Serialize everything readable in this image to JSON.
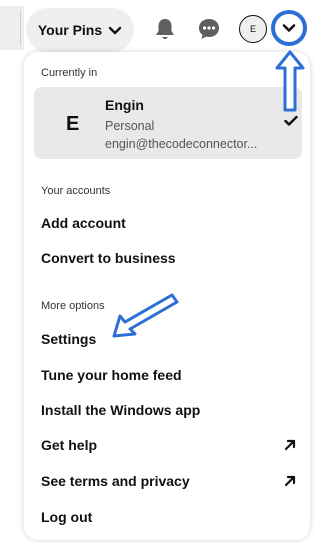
{
  "header": {
    "your_pins_label": "Your Pins",
    "avatar_initial": "E"
  },
  "current": {
    "section_label": "Currently in",
    "initial": "E",
    "name": "Engin",
    "type": "Personal",
    "email": "engin@thecodeconnector..."
  },
  "accounts": {
    "section_label": "Your accounts",
    "items": [
      "Add account",
      "Convert to business"
    ]
  },
  "more": {
    "section_label": "More options",
    "items": [
      "Settings",
      "Tune your home feed",
      "Install the Windows app",
      "Get help",
      "See terms and privacy",
      "Log out"
    ]
  },
  "icons": {
    "chevron": "chevron-down-icon",
    "bell": "bell-icon",
    "chat": "chat-bubble-icon",
    "check": "checkmark-icon",
    "external": "arrow-up-right-icon"
  },
  "colors": {
    "annotation_blue": "#2d6fd6",
    "card_gray": "#e9e9e9",
    "pill_gray": "#efefef"
  }
}
